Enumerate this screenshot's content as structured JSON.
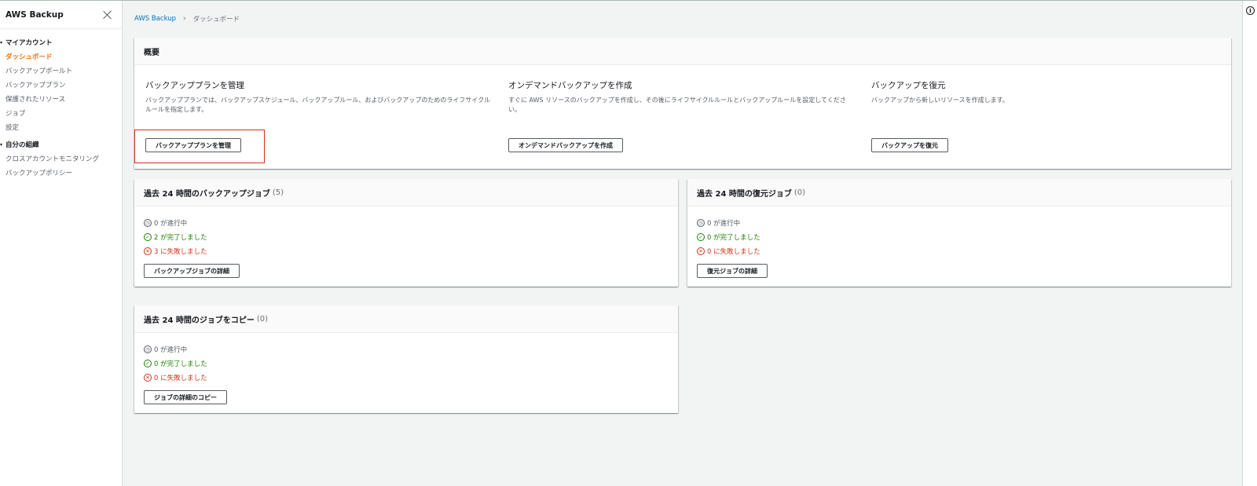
{
  "sidebar": {
    "title": "AWS Backup",
    "groups": [
      {
        "label": "マイアカウント",
        "items": [
          {
            "label": "ダッシュボード"
          },
          {
            "label": "バックアップボールト"
          },
          {
            "label": "バックアッププラン"
          },
          {
            "label": "保護されたリソース"
          },
          {
            "label": "ジョブ"
          },
          {
            "label": "設定"
          }
        ]
      },
      {
        "label": "自分の組織",
        "items": [
          {
            "label": "クロスアカウントモニタリング"
          },
          {
            "label": "バックアップポリシー"
          }
        ]
      }
    ]
  },
  "breadcrumb": {
    "root": "AWS Backup",
    "current": "ダッシュボード"
  },
  "overview": {
    "title": "概要",
    "columns": [
      {
        "title": "バックアッププランを管理",
        "description": "バックアッププランでは、バックアップスケジュール、バックアップルール、およびバックアップのためのライフサイクルルールを指定します。",
        "button": "バックアッププランを管理"
      },
      {
        "title": "オンデマンドバックアップを作成",
        "description": "すぐに AWS リソースのバックアップを作成し、その後にライフサイクルルールとバックアップルールを設定してください。",
        "button": "オンデマンドバックアップを作成"
      },
      {
        "title": "バックアップを復元",
        "description": "バックアップから新しいリソースを作成します。",
        "button": "バックアップを復元"
      }
    ]
  },
  "backup_jobs": {
    "title": "過去 24 時間のバックアップジョブ",
    "count": "(5)",
    "in_progress": "0 が進行中",
    "completed": "2 が完了しました",
    "failed": "3 に失敗しました",
    "button": "バックアップジョブの詳細"
  },
  "restore_jobs": {
    "title": "過去 24 時間の復元ジョブ",
    "count": "(0)",
    "in_progress": "0 が進行中",
    "completed": "0 が完了しました",
    "failed": "0 に失敗しました",
    "button": "復元ジョブの詳細"
  },
  "copy_jobs": {
    "title": "過去 24 時間のジョブをコピー",
    "count": "(0)",
    "in_progress": "0 が進行中",
    "completed": "0 が完了しました",
    "failed": "0 に失敗しました",
    "button": "ジョブの詳細のコピー"
  },
  "icons": {
    "in_progress": "clock-icon",
    "completed": "check-circle-icon",
    "failed": "x-circle-icon",
    "info": "info-icon"
  },
  "colors": {
    "active_nav": "#ec7211",
    "link": "#0073bb",
    "success": "#1d8102",
    "error": "#d13212",
    "background": "#f2f3f3"
  }
}
